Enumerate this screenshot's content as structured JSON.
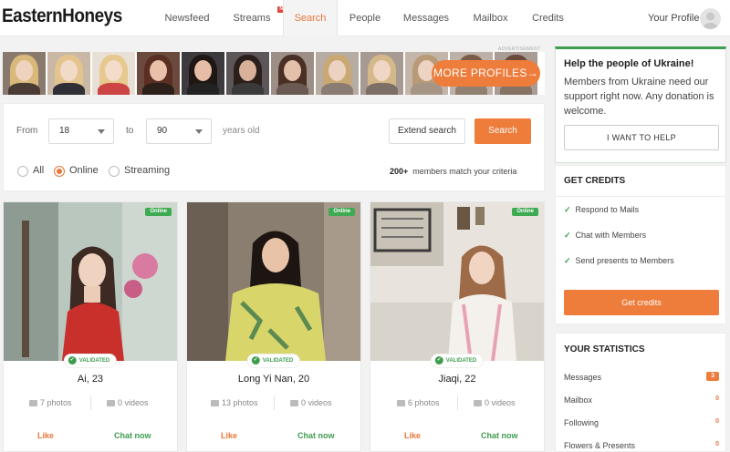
{
  "brand": "EasternHoneys",
  "nav": {
    "items": [
      "Newsfeed",
      "Streams",
      "Search",
      "People",
      "Messages",
      "Mailbox",
      "Credits"
    ],
    "new_badge": "NEW",
    "profile": "Your Profile"
  },
  "ad_label": "ADVERTISEMENT",
  "more_profiles": "MORE PROFILES→",
  "search": {
    "from_label": "From",
    "from_value": "18",
    "to_label": "to",
    "to_value": "90",
    "years_label": "years old",
    "extend": "Extend search",
    "submit": "Search",
    "radios": [
      "All",
      "Online",
      "Streaming"
    ],
    "match_count": "200+",
    "match_text": "members match your criteria"
  },
  "cards": [
    {
      "name": "Ai, 23",
      "photos": "7 photos",
      "videos": "0 videos",
      "online": "Online",
      "validated": "VALIDATED",
      "like": "Like",
      "chat": "Chat now"
    },
    {
      "name": "Long Yi Nan, 20",
      "photos": "13 photos",
      "videos": "0 videos",
      "online": "Online",
      "validated": "VALIDATED",
      "like": "Like",
      "chat": "Chat now"
    },
    {
      "name": "Jiaqi, 22",
      "photos": "6 photos",
      "videos": "0 videos",
      "online": "Online",
      "validated": "VALIDATED",
      "like": "Like",
      "chat": "Chat now"
    }
  ],
  "ukraine": {
    "title": "Help the people of Ukraine!",
    "text": "Members from Ukraine need our support right now. Any donation is welcome.",
    "button": "I WANT TO HELP"
  },
  "credits": {
    "title": "GET CREDITS",
    "items": [
      "Respond to Mails",
      "Chat with Members",
      "Send presents to Members"
    ],
    "button": "Get credits"
  },
  "stats": {
    "title": "YOUR STATISTICS",
    "rows": [
      {
        "label": "Messages",
        "value": "3"
      },
      {
        "label": "Mailbox",
        "value": "0"
      },
      {
        "label": "Following",
        "value": "0"
      },
      {
        "label": "Flowers & Presents",
        "value": "0"
      }
    ]
  },
  "colors": {
    "accent": "#ee7c3b",
    "green": "#3e9c4f"
  }
}
